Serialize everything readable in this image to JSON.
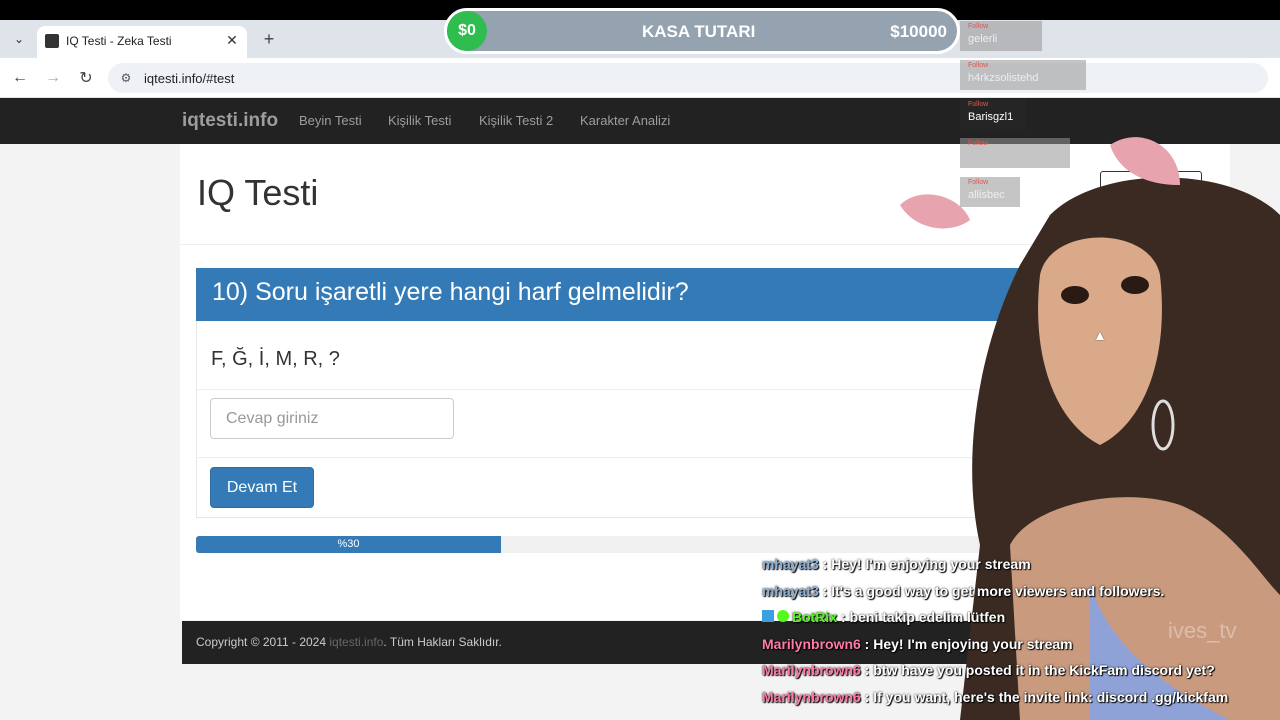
{
  "browser": {
    "tab_title": "IQ Testi - Zeka Testi",
    "url": "iqtesti.info/#test"
  },
  "site": {
    "brand": "iqtesti.info",
    "nav": [
      "Beyin Testi",
      "Kişilik Testi",
      "Kişilik Testi 2",
      "Karakter Analizi"
    ],
    "page_title": "IQ Testi",
    "question": "10) Soru işaretli yere hangi harf gelmelidir?",
    "sequence": "F, Ğ, İ, M, R, ?",
    "answer_placeholder": "Cevap giriniz",
    "submit_label": "Devam Et",
    "progress": {
      "label": "%30",
      "value": 0.3
    },
    "footer": {
      "copyright": "Copyright © 2011 - 2024 ",
      "link": "iqtesti.info",
      "suffix": ". Tüm Hakları Saklıdır."
    }
  },
  "overlay": {
    "money": {
      "current": "$0",
      "title": "KASA TUTARI",
      "goal": "$10000"
    },
    "follow_tag": "Follow",
    "followers": [
      "gelerli",
      "h4rkzsolistehd",
      "Barisgzl1",
      "",
      "allisbec"
    ],
    "watermark": "ives_tv",
    "chat": [
      {
        "user": "mhayat3",
        "text": " : Hey! I'm enjoying your stream",
        "color": "#8fb1d6"
      },
      {
        "user": "mhayat3",
        "text": " : It's a good way to get more viewers and followers.",
        "color": "#8fb1d6"
      },
      {
        "user": "BotRix",
        "text": " : beni takip edelim lütfen",
        "color": "#53fc18"
      },
      {
        "user": "Marilynbrown6",
        "text": " : Hey! I'm enjoying your stream",
        "color": "#ff7ba6"
      },
      {
        "user": "Marilynbrown6",
        "text": " : btw have you posted it in the KickFam discord yet?",
        "color": "#ff7ba6"
      },
      {
        "user": "Marilynbrown6",
        "text": " : If you want, here's the invite link: discord .gg/kickfam",
        "color": "#ff7ba6"
      }
    ]
  }
}
